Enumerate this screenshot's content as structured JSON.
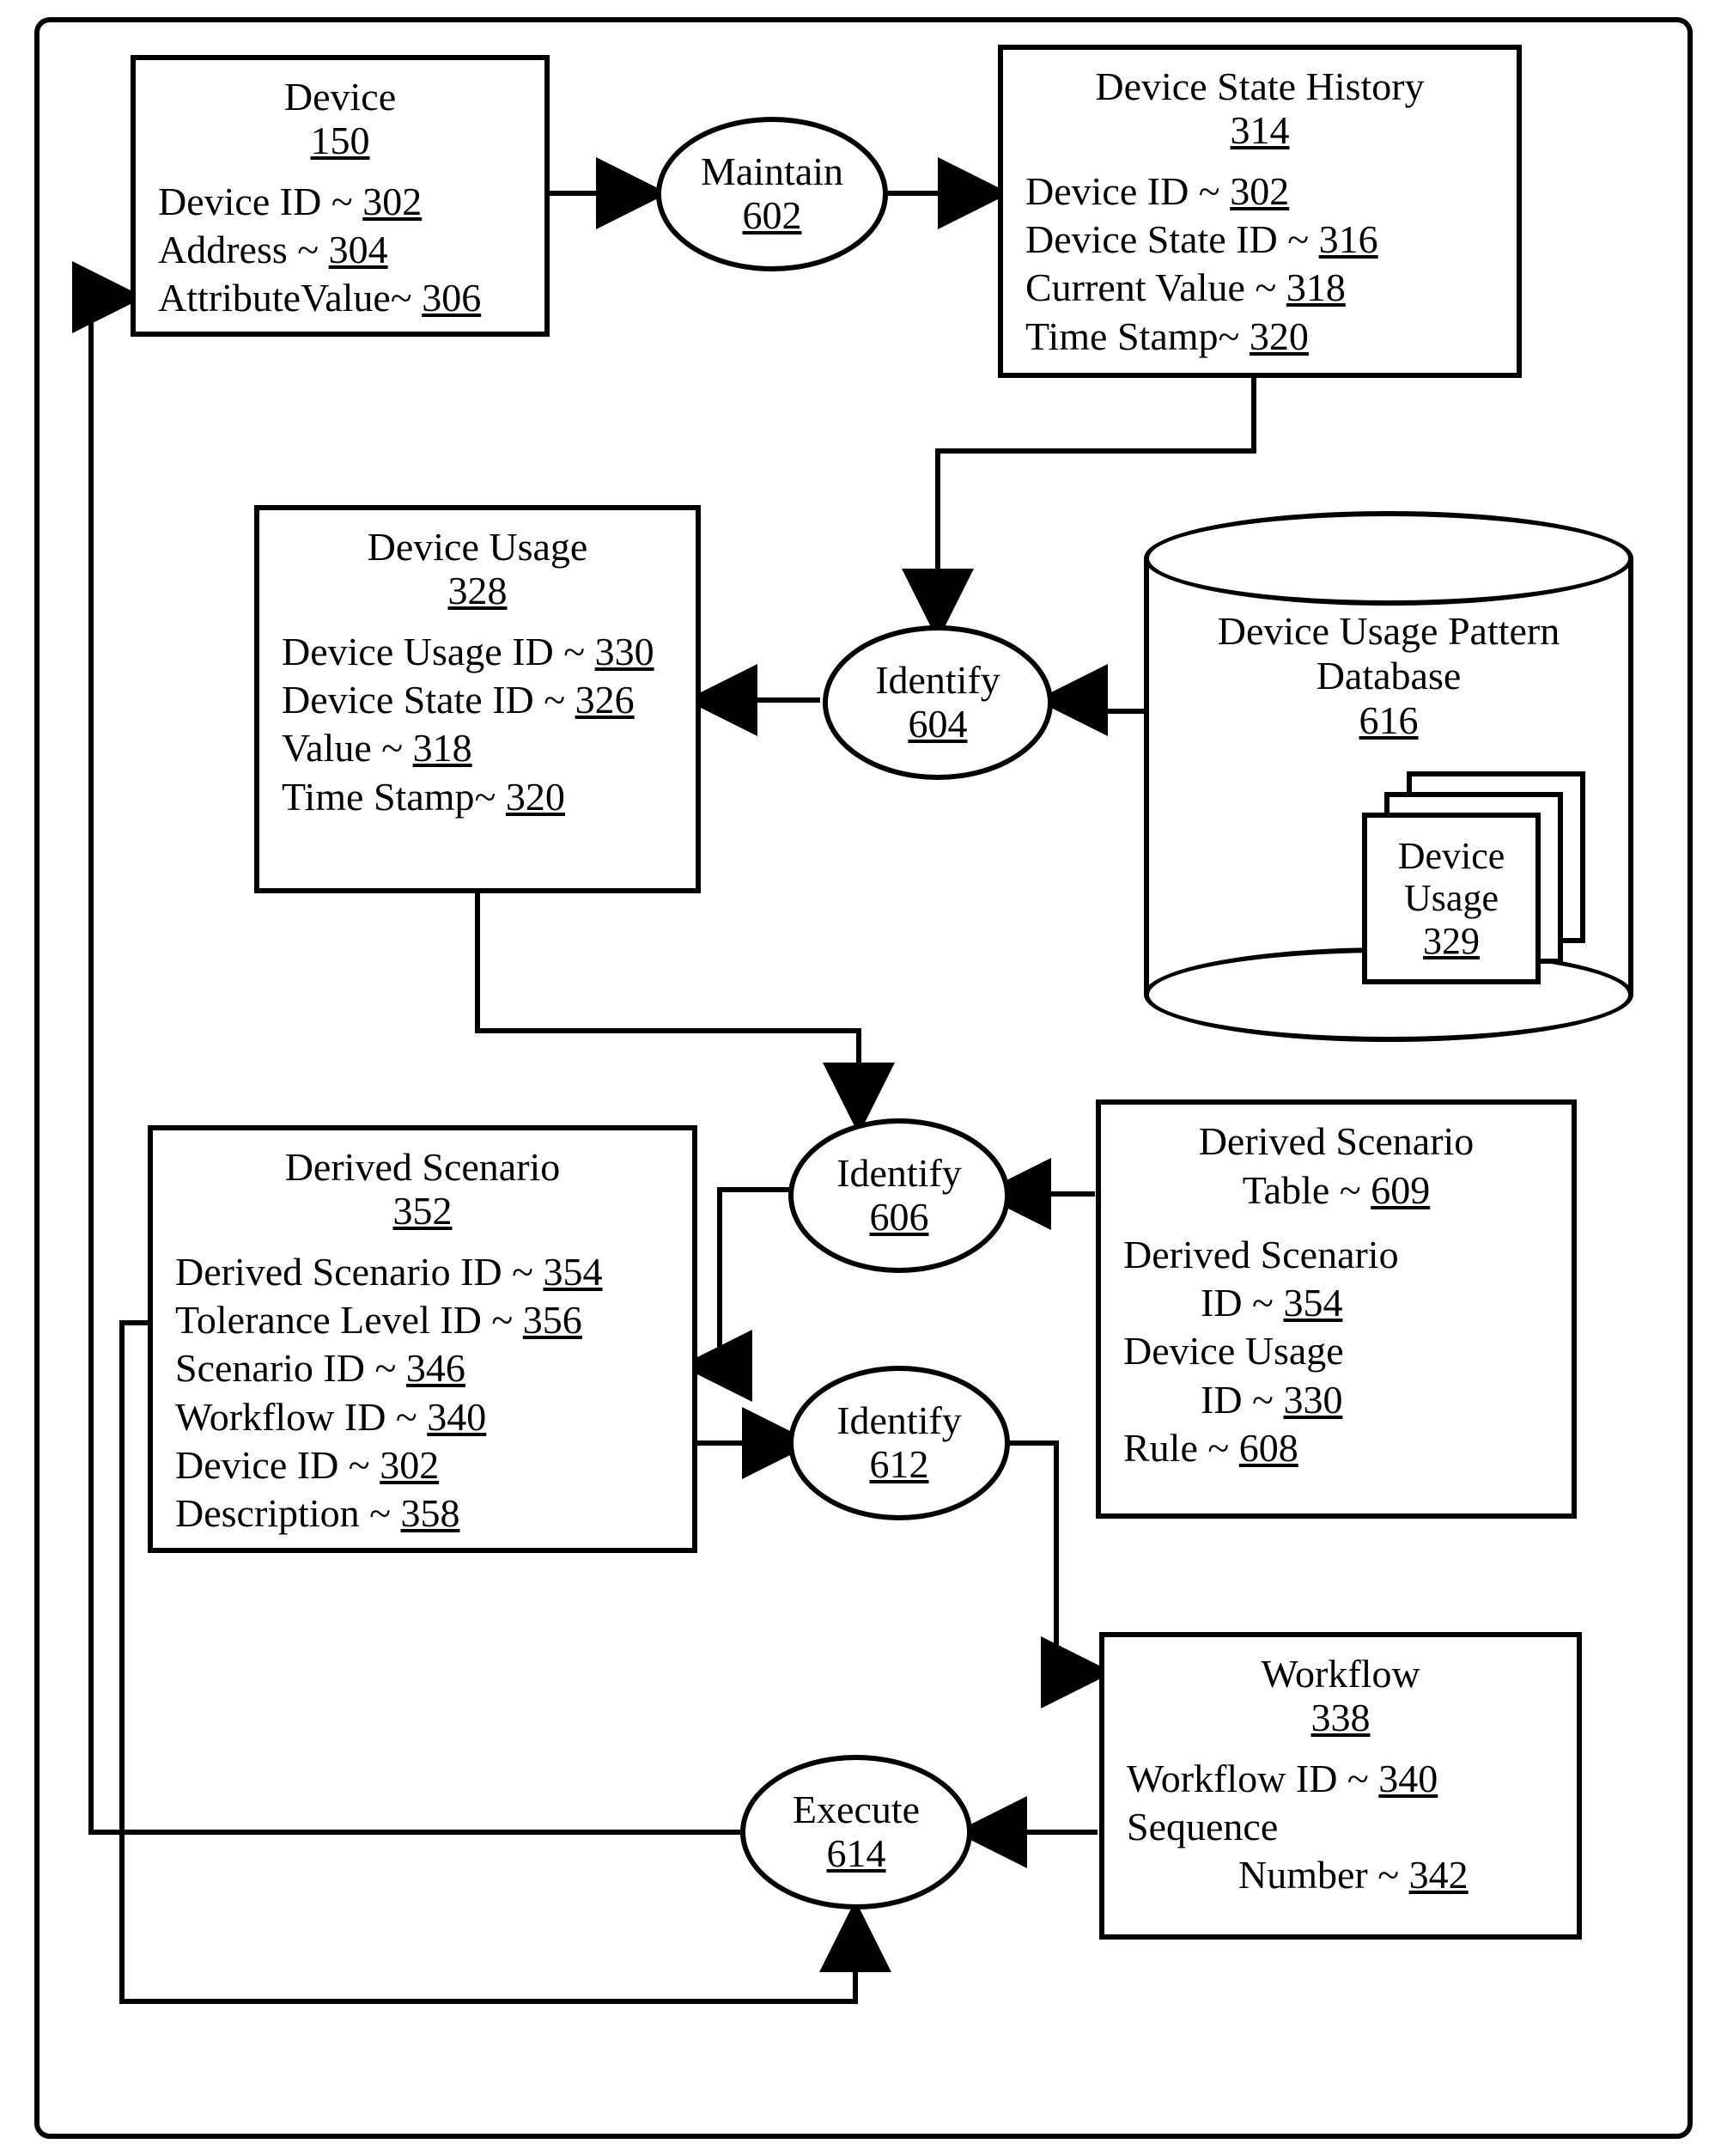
{
  "device": {
    "title": "Device",
    "num": "150",
    "a1": "Device ID ~ ",
    "a1n": "302",
    "a2": "Address ~ ",
    "a2n": "304",
    "a3": "AttributeValue~ ",
    "a3n": "306"
  },
  "history": {
    "title": "Device State History",
    "num": "314",
    "a1": "Device ID ~ ",
    "a1n": "302",
    "a2": "Device State ID ~ ",
    "a2n": "316",
    "a3": "Current Value ~ ",
    "a3n": "318",
    "a4": "Time Stamp~ ",
    "a4n": "320"
  },
  "usage": {
    "title": "Device Usage",
    "num": "328",
    "a1": "Device Usage ID ~ ",
    "a1n": "330",
    "a2": "Device State ID ~ ",
    "a2n": "326",
    "a3": "Value ~ ",
    "a3n": "318",
    "a4": "Time Stamp~ ",
    "a4n": "320"
  },
  "db": {
    "title1": "Device Usage Pattern",
    "title2": "Database",
    "num": "616",
    "d1": "Device",
    "d2": "Usage",
    "dnum": "329"
  },
  "derived": {
    "title": "Derived Scenario",
    "num": "352",
    "a1": "Derived Scenario ID ~ ",
    "a1n": "354",
    "a2": "Tolerance Level ID ~ ",
    "a2n": "356",
    "a3": "Scenario ID ~ ",
    "a3n": "346",
    "a4": "Workflow ID ~ ",
    "a4n": "340",
    "a5": "Device ID ~ ",
    "a5n": "302",
    "a6": "Description ~ ",
    "a6n": "358"
  },
  "dstable": {
    "t1": "Derived Scenario",
    "t2": "Table ~ ",
    "num": "609",
    "a1a": "Derived Scenario",
    "a1b": "ID ~ ",
    "a1n": "354",
    "a2a": "Device Usage",
    "a2b": "ID ~ ",
    "a2n": "330",
    "a3": "Rule ~ ",
    "a3n": "608"
  },
  "workflow": {
    "title": "Workflow",
    "num": "338",
    "a1": "Workflow ID ~ ",
    "a1n": "340",
    "a2a": "Sequence",
    "a2b": "Number ~ ",
    "a2n": "342"
  },
  "maintain": {
    "label": "Maintain",
    "num": "602"
  },
  "identify604": {
    "label": "Identify",
    "num": "604"
  },
  "identify606": {
    "label": "Identify",
    "num": "606"
  },
  "identify612": {
    "label": "Identify",
    "num": "612"
  },
  "execute": {
    "label": "Execute",
    "num": "614"
  }
}
